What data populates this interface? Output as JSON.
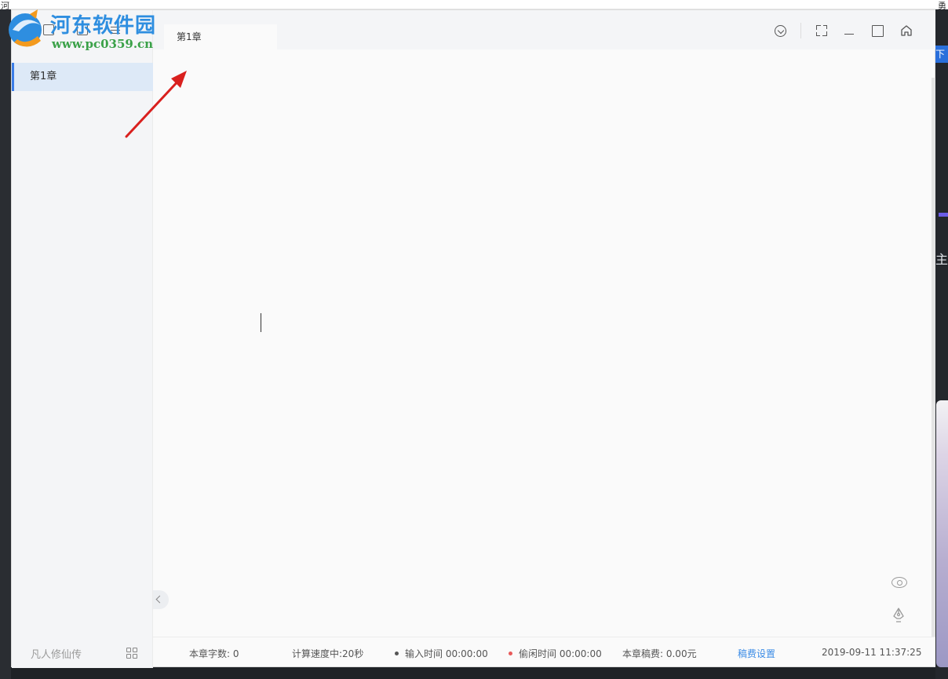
{
  "background": {
    "top_left_text": "河",
    "top_right_text": "勇",
    "right_tab_text": "下载",
    "right_char": "主"
  },
  "watermark": {
    "name": "河东软件园",
    "url": "www.pc0359.cn"
  },
  "sidebar": {
    "chapters": [
      {
        "label": "第1章",
        "active": true
      }
    ],
    "book_title": "凡人修仙传"
  },
  "tabs": [
    {
      "label": "第1章",
      "active": true
    }
  ],
  "window_controls": [
    "chevron-down-circle",
    "fullscreen",
    "minimize",
    "maximize",
    "home"
  ],
  "statusbar": {
    "word_count": "本章字数: 0",
    "speed": "计算速度中:20秒",
    "input_time": "输入时间 00:00:00",
    "idle_time": "偷闲时间 00:00:00",
    "fee": "本章稿费: 0.00元",
    "fee_settings": "稿费设置",
    "datetime": "2019-09-11 11:37:25"
  },
  "colors": {
    "accent": "#3b7de8",
    "active_chapter_bg": "#dde9f7",
    "input_dot": "#555555",
    "idle_dot": "#e85a5a",
    "link": "#3a8be6",
    "annotation_arrow": "#d9201e"
  }
}
